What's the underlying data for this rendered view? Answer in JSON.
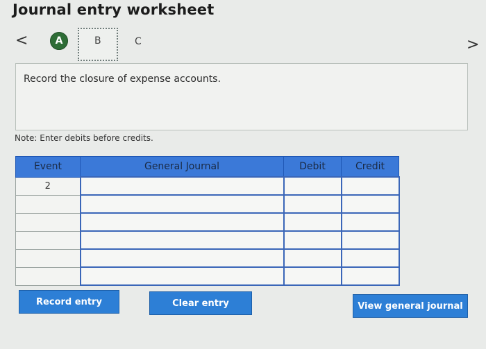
{
  "title": "Journal entry worksheet",
  "nav": {
    "prev": "<",
    "next": ">"
  },
  "steps": [
    "A",
    "B",
    "C"
  ],
  "prompt": "Record the closure of expense accounts.",
  "note": "Note: Enter debits before credits.",
  "table": {
    "headers": [
      "Event",
      "General Journal",
      "Debit",
      "Credit"
    ],
    "rows": [
      {
        "event": "2",
        "account": "",
        "debit": "",
        "credit": ""
      },
      {
        "event": "",
        "account": "",
        "debit": "",
        "credit": ""
      },
      {
        "event": "",
        "account": "",
        "debit": "",
        "credit": ""
      },
      {
        "event": "",
        "account": "",
        "debit": "",
        "credit": ""
      },
      {
        "event": "",
        "account": "",
        "debit": "",
        "credit": ""
      },
      {
        "event": "",
        "account": "",
        "debit": "",
        "credit": ""
      }
    ]
  },
  "buttons": {
    "record": "Record entry",
    "clear": "Clear entry",
    "view": "View general journal"
  }
}
